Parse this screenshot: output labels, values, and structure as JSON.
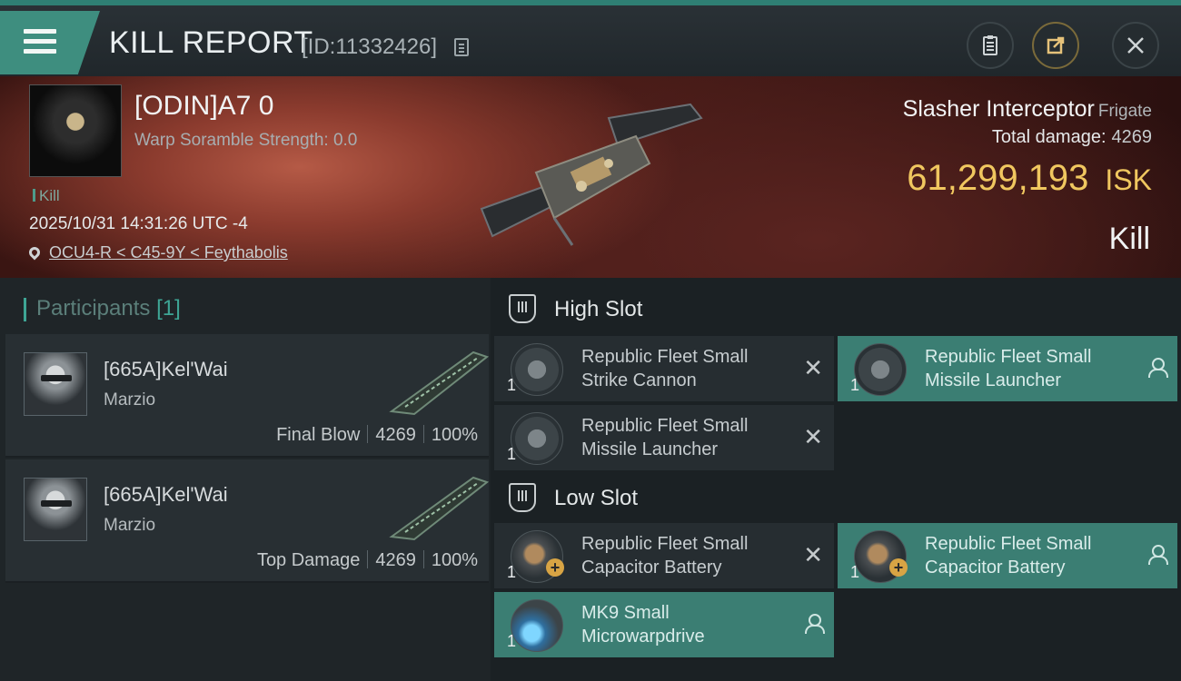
{
  "header": {
    "title": "KILL REPORT",
    "report_id": "[ID:11332426]"
  },
  "victim": {
    "name": "[ODIN]A7 0",
    "warp_scramble": "Warp Soramble Strength: 0.0",
    "tag": "Kill",
    "datetime": "2025/10/31 14:31:26 UTC -4",
    "location": "OCU4-R < C45-9Y < Feythabolis",
    "ship_name": "Slasher Interceptor",
    "ship_class": "Frigate",
    "total_damage_label": "Total damage:",
    "total_damage": "4269",
    "isk_value": "61,299,193",
    "isk_unit": "ISK",
    "result": "Kill"
  },
  "participants": {
    "title": "Participants",
    "count": "[1]",
    "rows": [
      {
        "name": "[665A]Kel'Wai",
        "corp": "Marzio",
        "label": "Final Blow",
        "damage": "4269",
        "percent": "100%"
      },
      {
        "name": "[665A]Kel'Wai",
        "corp": "Marzio",
        "label": "Top Damage",
        "damage": "4269",
        "percent": "100%"
      }
    ]
  },
  "slots": {
    "high_title": "High Slot",
    "low_title": "Low Slot",
    "high_items": [
      {
        "qty": "1",
        "name": "Republic Fleet Small Strike Cannon",
        "state": "destroyed"
      },
      {
        "qty": "1",
        "name": "Republic Fleet Small Missile Launcher",
        "state": "dropped"
      },
      {
        "qty": "1",
        "name": "Republic Fleet Small Missile Launcher",
        "state": "destroyed"
      }
    ],
    "low_items": [
      {
        "qty": "1",
        "name": "Republic Fleet Small Capacitor Battery",
        "state": "destroyed"
      },
      {
        "qty": "1",
        "name": "Republic Fleet Small Capacitor Battery",
        "state": "dropped"
      },
      {
        "qty": "1",
        "name": "MK9 Small Microwarpdrive",
        "state": "dropped"
      }
    ]
  },
  "icons": {
    "menu": "hamburger-icon",
    "copy": "copy-icon",
    "clipboard": "clipboard-icon",
    "share": "share-icon",
    "close": "close-icon",
    "destroyed": "x-icon",
    "dropped": "person-icon"
  },
  "colors": {
    "accent": "#3e8e7f",
    "isk": "#f0c75f",
    "dropped_bg": "#3b7e73"
  }
}
